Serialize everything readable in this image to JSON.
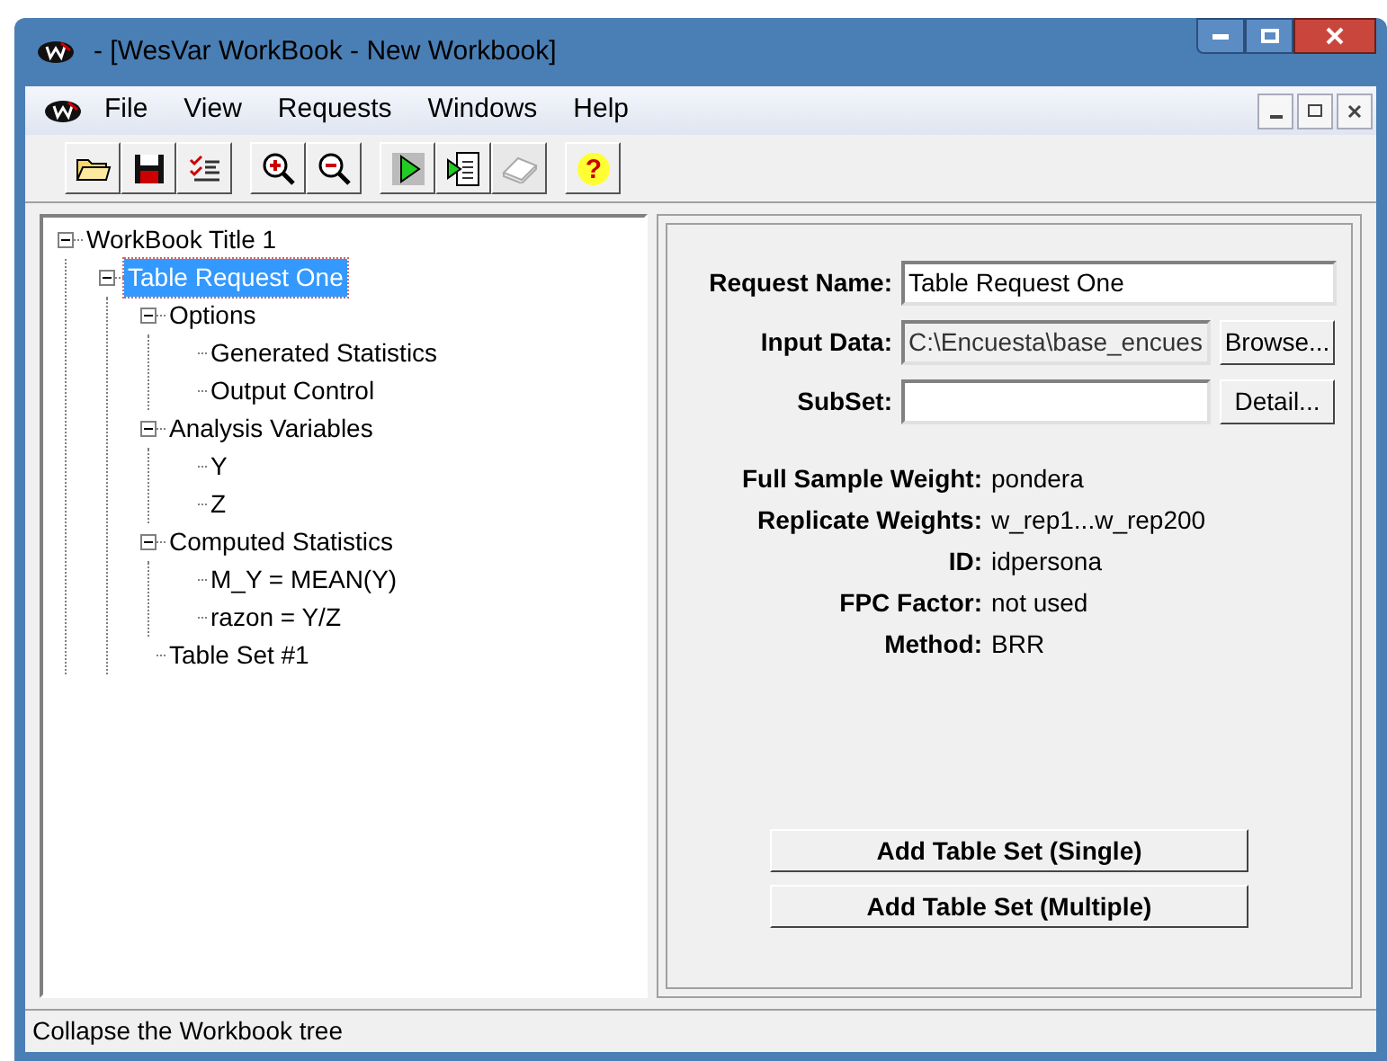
{
  "window": {
    "title": "- [WesVar WorkBook - New Workbook]"
  },
  "menu": [
    {
      "label": "File"
    },
    {
      "label": "View"
    },
    {
      "label": "Requests"
    },
    {
      "label": "Windows"
    },
    {
      "label": "Help"
    }
  ],
  "toolbar": [
    {
      "kind": "open",
      "disabled": false
    },
    {
      "kind": "save",
      "disabled": false
    },
    {
      "kind": "checklist",
      "disabled": false
    },
    {
      "kind": "sep"
    },
    {
      "kind": "zoom-in",
      "disabled": false
    },
    {
      "kind": "zoom-out",
      "disabled": false
    },
    {
      "kind": "sep"
    },
    {
      "kind": "run",
      "disabled": false
    },
    {
      "kind": "export",
      "disabled": false
    },
    {
      "kind": "book",
      "disabled": true
    },
    {
      "kind": "sep"
    },
    {
      "kind": "help",
      "disabled": false,
      "glyph": "?"
    }
  ],
  "tree": [
    {
      "label": "WorkBook Title 1",
      "expanded": true,
      "selected": false,
      "children": [
        {
          "label": "Table Request One",
          "expanded": true,
          "selected": true,
          "children": [
            {
              "label": "Options",
              "expanded": true,
              "selected": false,
              "children": [
                {
                  "label": "Generated Statistics",
                  "selected": false
                },
                {
                  "label": "Output Control",
                  "selected": false
                }
              ]
            },
            {
              "label": "Analysis Variables",
              "expanded": true,
              "selected": false,
              "children": [
                {
                  "label": "Y",
                  "selected": false
                },
                {
                  "label": "Z",
                  "selected": false
                }
              ]
            },
            {
              "label": "Computed Statistics",
              "expanded": true,
              "selected": false,
              "children": [
                {
                  "label": "M_Y = MEAN(Y)",
                  "selected": false
                },
                {
                  "label": "razon = Y/Z",
                  "selected": false
                }
              ]
            },
            {
              "label": "Table Set #1",
              "selected": false
            }
          ]
        }
      ]
    }
  ],
  "form": [
    {
      "label": "Request Name:",
      "value": "Table Request One",
      "disabled": false
    },
    {
      "label": "Input Data:",
      "value": "C:\\Encuesta\\base_encues",
      "disabled": true,
      "button": "Browse..."
    },
    {
      "label": "SubSet:",
      "disabled": false,
      "button": "Detail..."
    }
  ],
  "info": [
    {
      "label": "Full Sample Weight:",
      "value": "pondera"
    },
    {
      "label": "Replicate Weights:",
      "value": "w_rep1...w_rep200"
    },
    {
      "label": "ID:",
      "value": "idpersona"
    },
    {
      "label": "FPC Factor:",
      "value": "not used"
    },
    {
      "label": "Method:",
      "value": "BRR"
    }
  ],
  "actions": [
    {
      "label": "Add Table Set (Single)"
    },
    {
      "label": "Add Table Set (Multiple)"
    }
  ],
  "status_bar": {
    "text": "Collapse the Workbook tree"
  }
}
